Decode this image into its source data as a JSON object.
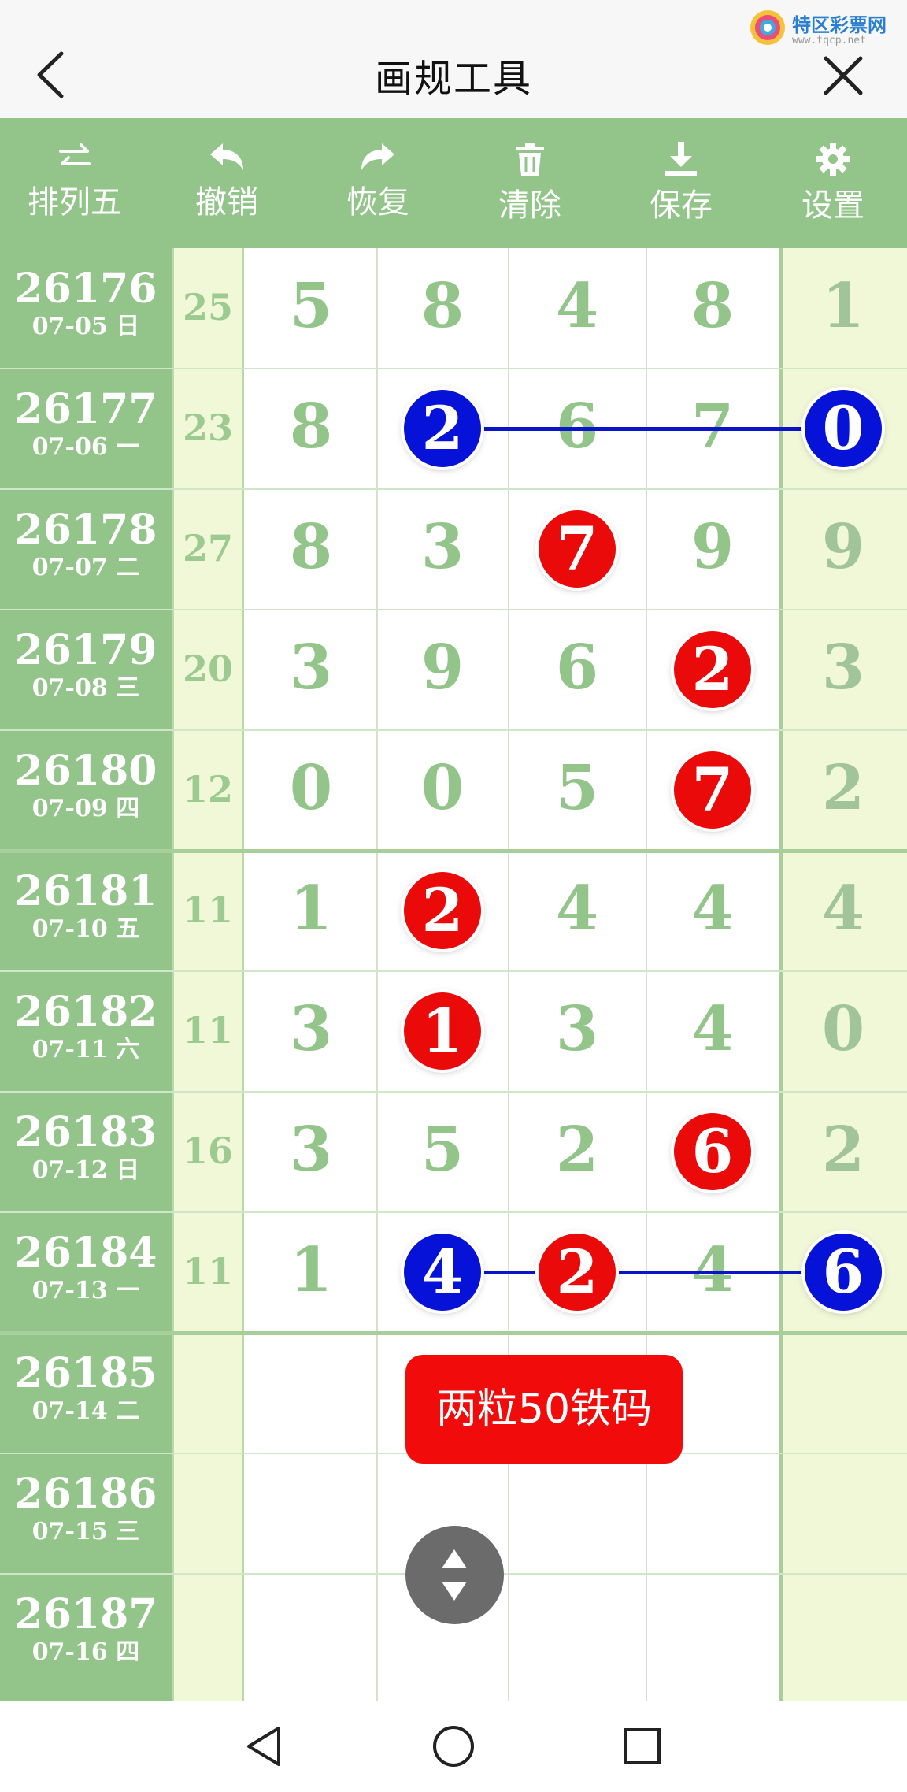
{
  "header": {
    "title": "画规工具",
    "watermark_text": "特区彩票网",
    "watermark_url": "www.tqcp.net"
  },
  "toolbar": {
    "items": [
      {
        "label": "排列五",
        "icon": "swap-arrows-icon"
      },
      {
        "label": "撤销",
        "icon": "undo-icon"
      },
      {
        "label": "恢复",
        "icon": "redo-icon"
      },
      {
        "label": "清除",
        "icon": "trash-icon"
      },
      {
        "label": "保存",
        "icon": "download-icon"
      },
      {
        "label": "设置",
        "icon": "gear-icon"
      }
    ]
  },
  "rows": [
    {
      "issue": "26176",
      "date": "07-05 日",
      "sum": "25",
      "digits": [
        "5",
        "8",
        "4",
        "8",
        "1"
      ]
    },
    {
      "issue": "26177",
      "date": "07-06 一",
      "sum": "23",
      "digits": [
        "8",
        "2",
        "6",
        "7",
        "0"
      ]
    },
    {
      "issue": "26178",
      "date": "07-07 二",
      "sum": "27",
      "digits": [
        "8",
        "3",
        "7",
        "9",
        "9"
      ]
    },
    {
      "issue": "26179",
      "date": "07-08 三",
      "sum": "20",
      "digits": [
        "3",
        "9",
        "6",
        "2",
        "3"
      ]
    },
    {
      "issue": "26180",
      "date": "07-09 四",
      "sum": "12",
      "digits": [
        "0",
        "0",
        "5",
        "7",
        "2"
      ]
    },
    {
      "issue": "26181",
      "date": "07-10 五",
      "sum": "11",
      "digits": [
        "1",
        "2",
        "4",
        "4",
        "4"
      ]
    },
    {
      "issue": "26182",
      "date": "07-11 六",
      "sum": "11",
      "digits": [
        "3",
        "1",
        "3",
        "4",
        "0"
      ]
    },
    {
      "issue": "26183",
      "date": "07-12 日",
      "sum": "16",
      "digits": [
        "3",
        "5",
        "2",
        "6",
        "2"
      ]
    },
    {
      "issue": "26184",
      "date": "07-13 一",
      "sum": "11",
      "digits": [
        "1",
        "4",
        "2",
        "4",
        "6"
      ]
    },
    {
      "issue": "26185",
      "date": "07-14 二",
      "sum": "",
      "digits": [
        "",
        "",
        "",
        "",
        ""
      ]
    },
    {
      "issue": "26186",
      "date": "07-15 三",
      "sum": "",
      "digits": [
        "",
        "",
        "",
        "",
        ""
      ]
    },
    {
      "issue": "26187",
      "date": "07-16 四",
      "sum": "",
      "digits": [
        "",
        "",
        "",
        "",
        ""
      ]
    }
  ],
  "marks": [
    {
      "row": 1,
      "col": 1,
      "color": "blue"
    },
    {
      "row": 1,
      "col": 4,
      "color": "blue"
    },
    {
      "row": 2,
      "col": 2,
      "color": "red"
    },
    {
      "row": 3,
      "col": 3,
      "color": "red"
    },
    {
      "row": 4,
      "col": 3,
      "color": "red"
    },
    {
      "row": 5,
      "col": 1,
      "color": "red"
    },
    {
      "row": 6,
      "col": 1,
      "color": "red"
    },
    {
      "row": 7,
      "col": 3,
      "color": "red"
    },
    {
      "row": 8,
      "col": 1,
      "color": "blue"
    },
    {
      "row": 8,
      "col": 2,
      "color": "red"
    },
    {
      "row": 8,
      "col": 4,
      "color": "blue"
    }
  ],
  "connectors": [
    {
      "row": 1,
      "from_col": 1,
      "to_col": 4
    },
    {
      "row": 8,
      "from_col": 1,
      "to_col": 4
    }
  ],
  "note_button": "两粒50铁码",
  "colors": {
    "theme_green": "#93c48a",
    "ball_red": "#ea0a0a",
    "ball_blue": "#0612d8",
    "note_red": "#f20b0b"
  },
  "navbar": {
    "items": [
      "back-triangle-icon",
      "home-circle-icon",
      "recents-square-icon"
    ]
  }
}
